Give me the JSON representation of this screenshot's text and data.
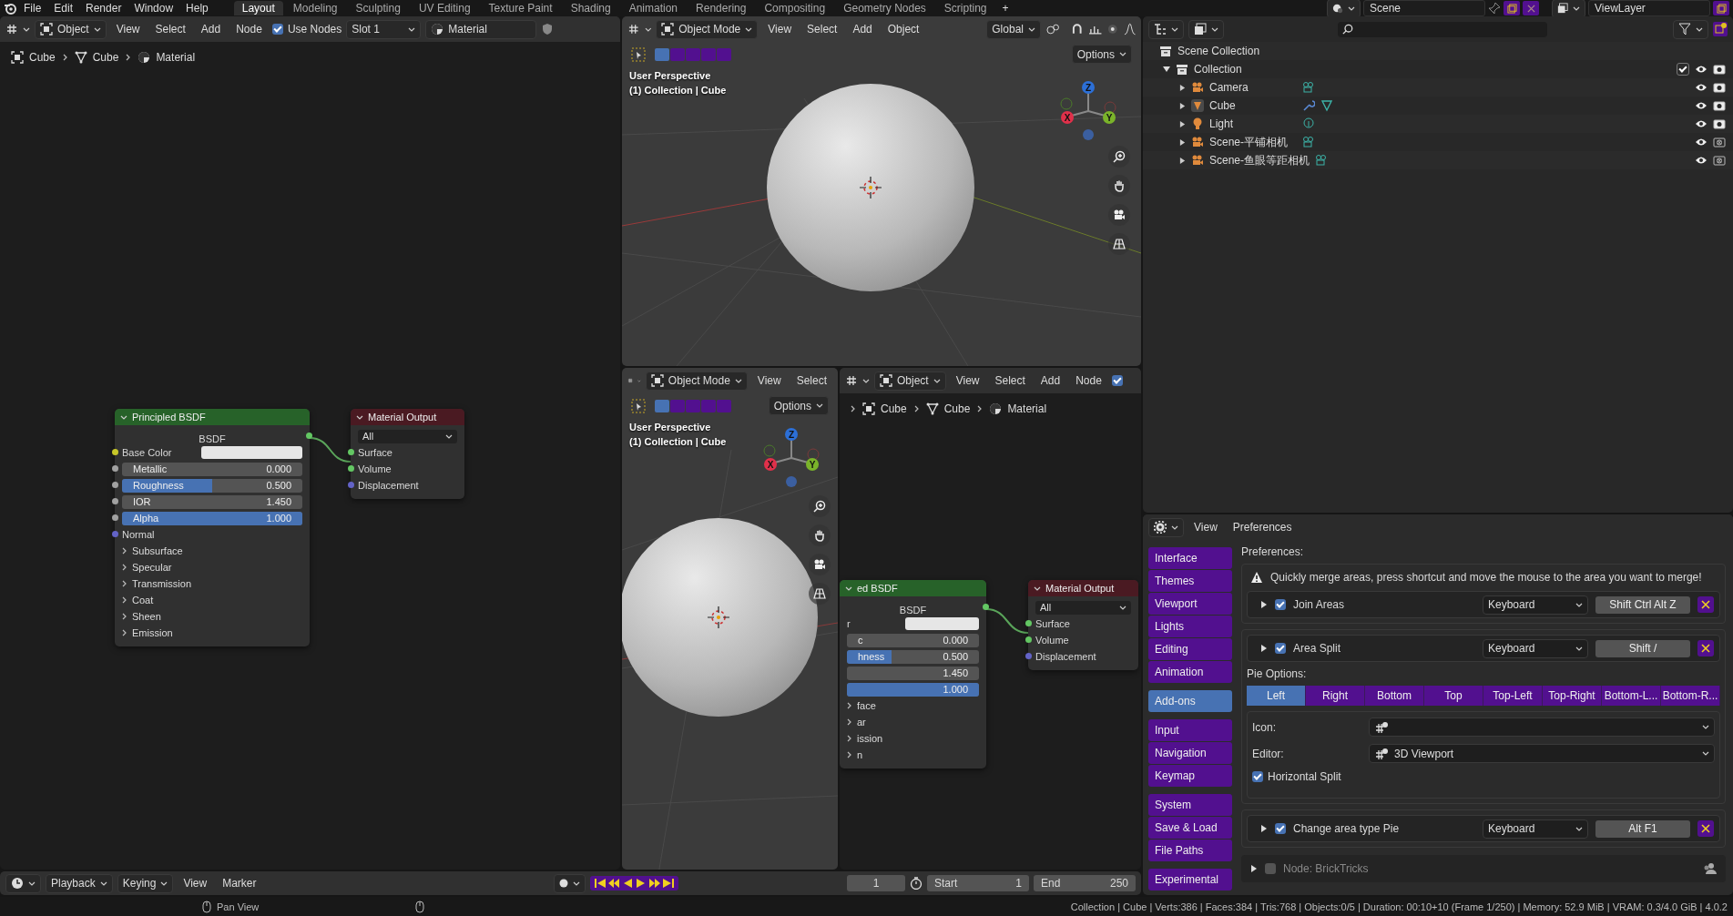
{
  "menu_bar": {
    "menus": [
      "File",
      "Edit",
      "Render",
      "Window",
      "Help"
    ],
    "workspaces": [
      {
        "label": "Layout",
        "selected": true
      },
      {
        "label": "Modeling",
        "selected": false
      },
      {
        "label": "Sculpting",
        "selected": false
      },
      {
        "label": "UV Editing",
        "selected": false
      },
      {
        "label": "Texture Paint",
        "selected": false
      },
      {
        "label": "Shading",
        "selected": false
      },
      {
        "label": "Animation",
        "selected": false
      },
      {
        "label": "Rendering",
        "selected": false
      },
      {
        "label": "Compositing",
        "selected": false
      },
      {
        "label": "Geometry Nodes",
        "selected": false
      },
      {
        "label": "Scripting",
        "selected": false
      }
    ],
    "add_workspace": "+",
    "scene": "Scene",
    "view_layer": "ViewLayer"
  },
  "node_editor": {
    "header": {
      "mode": "Object",
      "menus": [
        "View",
        "Select",
        "Add",
        "Node"
      ],
      "use_nodes": {
        "label": "Use Nodes",
        "checked": true
      },
      "slot": "Slot 1",
      "material": "Material"
    },
    "breadcrumbs": [
      {
        "kind": "object",
        "label": "Cube"
      },
      {
        "kind": "mesh",
        "label": "Cube"
      },
      {
        "kind": "material",
        "label": "Material"
      }
    ],
    "nodes": [
      {
        "kind": "shader",
        "title": "Principled BSDF",
        "output": {
          "label": "BSDF",
          "color": "#63c763"
        },
        "inputs": [
          {
            "kind": "color",
            "label": "Base Color",
            "color": "#c7c729"
          },
          {
            "kind": "slider",
            "label": "Metallic",
            "value": "0.000",
            "level": 0,
            "color": "#a1a1a1"
          },
          {
            "kind": "slider",
            "label": "Roughness",
            "value": "0.500",
            "level": 0.5,
            "color": "#a1a1a1"
          },
          {
            "kind": "number",
            "label": "IOR",
            "value": "1.450",
            "color": "#a1a1a1"
          },
          {
            "kind": "slider",
            "label": "Alpha",
            "value": "1.000",
            "level": 1,
            "color": "#a1a1a1"
          },
          {
            "kind": "socket",
            "label": "Normal",
            "color": "#6363c7"
          },
          {
            "kind": "panel",
            "label": "Subsurface"
          },
          {
            "kind": "panel",
            "label": "Specular"
          },
          {
            "kind": "panel",
            "label": "Transmission"
          },
          {
            "kind": "panel",
            "label": "Coat"
          },
          {
            "kind": "panel",
            "label": "Sheen"
          },
          {
            "kind": "panel",
            "label": "Emission"
          }
        ]
      },
      {
        "kind": "output",
        "title": "Material Output",
        "target": "All",
        "inputs": [
          {
            "kind": "socket",
            "label": "Surface",
            "color": "#63c763"
          },
          {
            "kind": "socket",
            "label": "Volume",
            "color": "#63c763"
          },
          {
            "kind": "socket",
            "label": "Displacement",
            "color": "#6363c7"
          }
        ]
      }
    ]
  },
  "viewport": {
    "header": {
      "mode": "Object Mode",
      "menus": [
        "View",
        "Select",
        "Add",
        "Object"
      ],
      "orientation": "Global",
      "options": "Options"
    },
    "selection_modes": [
      {
        "selected": true
      },
      {
        "selected": false
      },
      {
        "selected": false
      },
      {
        "selected": false
      },
      {
        "selected": false
      }
    ],
    "overlay": [
      "User Perspective",
      "(1) Collection | Cube"
    ],
    "gizmo": [
      "Z",
      "X",
      "Y"
    ]
  },
  "mini_viewport": {
    "header": {
      "mode": "Object Mode",
      "menus": [
        "View",
        "Select"
      ],
      "options": "Options"
    },
    "selection_modes": [
      {
        "selected": true
      },
      {
        "selected": false
      },
      {
        "selected": false
      },
      {
        "selected": false
      },
      {
        "selected": false
      }
    ],
    "overlay": [
      "User Perspective",
      "(1) Collection | Cube"
    ],
    "gizmo": [
      "Z",
      "X",
      "Y"
    ]
  },
  "node_editor_2": {
    "header": {
      "mode": "Object",
      "menus": [
        "View",
        "Select",
        "Add",
        "Node"
      ],
      "use_nodes": {
        "checked": true
      }
    },
    "breadcrumbs": [
      {
        "kind": "object",
        "label": "Cube"
      },
      {
        "kind": "mesh",
        "label": "Cube"
      },
      {
        "kind": "material",
        "label": "Material"
      }
    ],
    "nodes": [
      {
        "kind": "shader",
        "title": "ed BSDF",
        "output": {
          "label": "BSDF",
          "color": "#63c763"
        },
        "inputs": [
          {
            "kind": "color",
            "label": "r"
          },
          {
            "kind": "slider",
            "label": "c",
            "value": "0.000",
            "level": 0
          },
          {
            "kind": "slider",
            "label": "hness",
            "value": "0.500",
            "level": 0.34
          },
          {
            "kind": "number",
            "value": "1.450"
          },
          {
            "kind": "slider",
            "value": "1.000",
            "level": 1
          },
          {
            "kind": "panel",
            "label": "face"
          },
          {
            "kind": "panel",
            "label": "ar"
          },
          {
            "kind": "panel",
            "label": "ission"
          },
          {
            "kind": "panel",
            "label": "n"
          }
        ]
      },
      {
        "kind": "output",
        "title": "Material Output",
        "target": "All",
        "inputs": [
          {
            "kind": "socket",
            "label": "Surface",
            "color": "#63c763"
          },
          {
            "kind": "socket",
            "label": "Volume",
            "color": "#63c763"
          },
          {
            "kind": "socket",
            "label": "Displacement",
            "color": "#6363c7"
          }
        ]
      }
    ]
  },
  "outliner": {
    "root": "Scene Collection",
    "collection": {
      "name": "Collection",
      "expanded": true,
      "checked": true,
      "children": [
        {
          "name": "Camera",
          "kind": "camera",
          "renderable": true
        },
        {
          "name": "Cube",
          "kind": "mesh",
          "renderable": true
        },
        {
          "name": "Light",
          "kind": "light",
          "renderable": true
        },
        {
          "name": "Scene-平铺相机",
          "kind": "camera",
          "renderable": false
        },
        {
          "name": "Scene-鱼眼等距相机",
          "kind": "camera",
          "renderable": false
        }
      ]
    }
  },
  "preferences": {
    "menus": [
      "View",
      "Preferences"
    ],
    "sections": [
      [
        {
          "label": "Interface",
          "selected": false
        },
        {
          "label": "Themes",
          "selected": false
        },
        {
          "label": "Viewport",
          "selected": false
        },
        {
          "label": "Lights",
          "selected": false
        },
        {
          "label": "Editing",
          "selected": false
        },
        {
          "label": "Animation",
          "selected": false
        }
      ],
      [
        {
          "label": "Add-ons",
          "selected": true
        }
      ],
      [
        {
          "label": "Input",
          "selected": false
        },
        {
          "label": "Navigation",
          "selected": false
        },
        {
          "label": "Keymap",
          "selected": false
        }
      ],
      [
        {
          "label": "System",
          "selected": false
        },
        {
          "label": "Save & Load",
          "selected": false
        },
        {
          "label": "File Paths",
          "selected": false
        }
      ],
      [
        {
          "label": "Experimental",
          "selected": false
        }
      ]
    ],
    "heading": "Preferences:",
    "keymaps": [
      {
        "note": "Quickly merge areas, press shortcut and move the mouse to the area you want to merge!",
        "expanded": false,
        "checked": true,
        "name": "Join Areas",
        "input": "Keyboard",
        "shortcut": "Shift Ctrl Alt Z"
      },
      {
        "expanded": false,
        "checked": true,
        "name": "Area Split",
        "input": "Keyboard",
        "shortcut": "Shift /",
        "pie_options": {
          "label": "Pie Options:",
          "tabs": [
            {
              "label": "Left",
              "selected": true
            },
            {
              "label": "Right",
              "selected": false
            },
            {
              "label": "Bottom",
              "selected": false
            },
            {
              "label": "Top",
              "selected": false
            },
            {
              "label": "Top-Left",
              "selected": false
            },
            {
              "label": "Top-Right",
              "selected": false
            },
            {
              "label": "Bottom-L...",
              "selected": false
            },
            {
              "label": "Bottom-R...",
              "selected": false
            }
          ],
          "icon_label": "Icon:",
          "editor_label": "Editor:",
          "editor": "3D Viewport",
          "horizontal_split": {
            "label": "Horizontal Split",
            "checked": true
          }
        }
      },
      {
        "expanded": false,
        "checked": true,
        "name": "Change area type Pie",
        "input": "Keyboard",
        "shortcut": "Alt F1"
      }
    ],
    "addon": {
      "expanded": false,
      "checked": false,
      "name": "Node: BrickTricks"
    }
  },
  "timeline": {
    "menus": [
      {
        "kind": "dropdown",
        "label": "Playback"
      },
      {
        "kind": "dropdown",
        "label": "Keying"
      },
      {
        "kind": "menu",
        "label": "View"
      },
      {
        "kind": "menu",
        "label": "Marker"
      }
    ],
    "current_frame": "1",
    "start": {
      "label": "Start",
      "value": "1"
    },
    "end": {
      "label": "End",
      "value": "250"
    }
  },
  "status_bar": {
    "hint": "Pan View",
    "stats": "Collection | Cube | Verts:386 | Faces:384 | Tris:768 | Objects:0/5 | Duration: 00:10+10 (Frame 1/250) | Memory: 52.9 MiB | VRAM: 0.3/4.0 GiB | 4.0.2"
  }
}
